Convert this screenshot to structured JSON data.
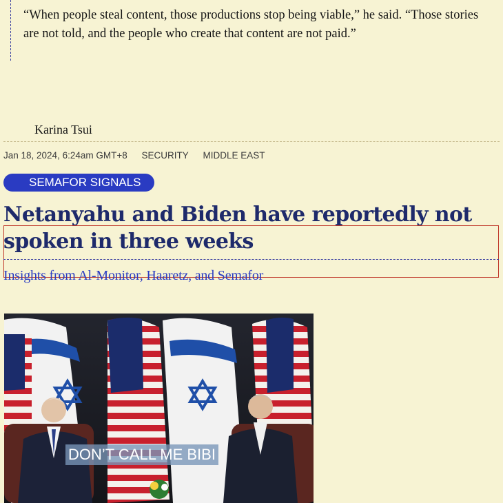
{
  "quote": "“When people steal content, those productions stop being viable,” he said. “Those stories are not told, and the people who create that content are not paid.”",
  "byline": {
    "author": "Karina Tsui"
  },
  "meta": {
    "date": "Jan 18, 2024, 6:24am GMT+8",
    "tags": [
      "SECURITY",
      "MIDDLE EAST"
    ]
  },
  "badge": {
    "label": "SEMAFOR SIGNALS"
  },
  "article": {
    "headline": "Netanyahu and Biden have reportedly not spoken in three weeks",
    "subhead": "Insights from Al-Monitor, Haaretz, and Semafor"
  },
  "photo": {
    "caption": "DON’T CALL ME BIBI"
  },
  "colors": {
    "background": "#f7f3d3",
    "headline": "#1e2a6b",
    "accent": "#2a3bc2"
  }
}
